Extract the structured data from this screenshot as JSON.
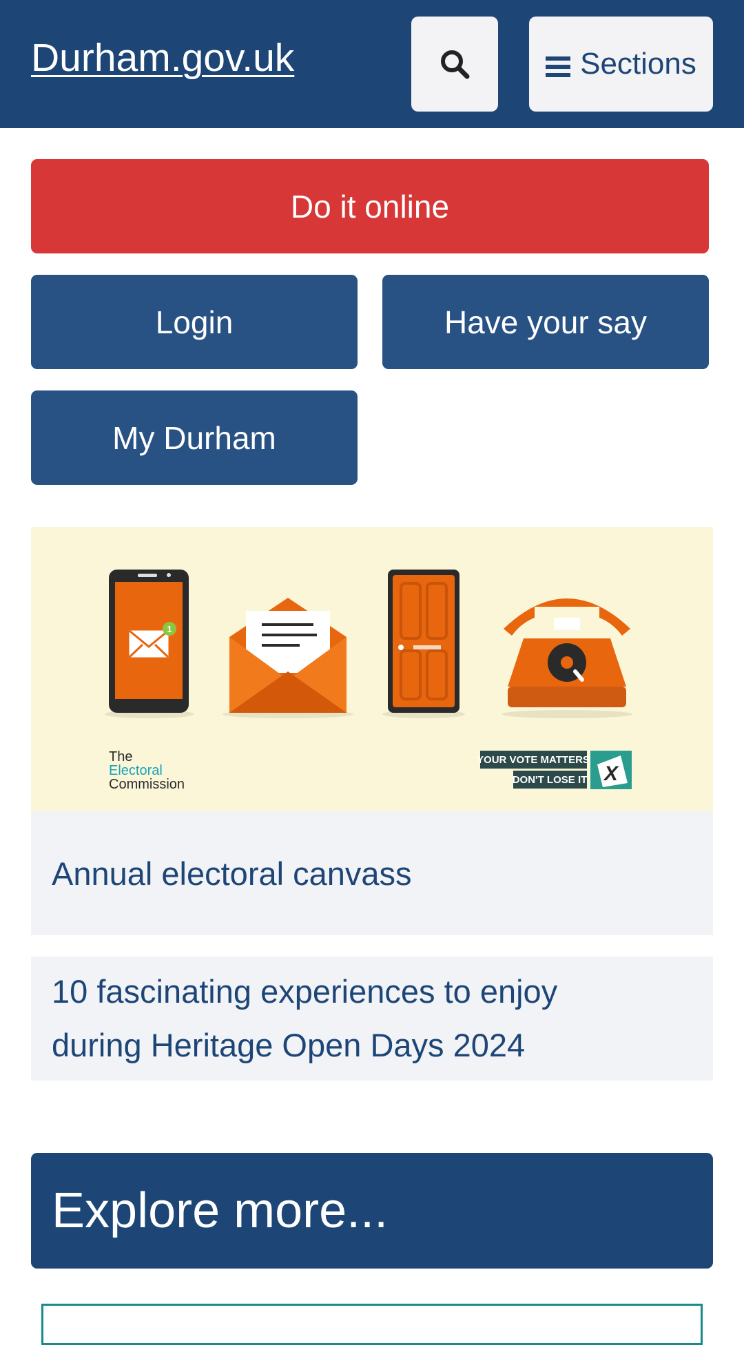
{
  "header": {
    "logo_text": "Durham.gov.uk",
    "search_icon": "search-icon",
    "sections_label": "Sections",
    "menu_icon": "hamburger-menu-icon",
    "background_color": "#1d4677"
  },
  "actions": {
    "do_it_online": "Do it online",
    "login": "Login",
    "have_your_say": "Have your say",
    "my_durham": "My Durham",
    "primary_color": "#d73737",
    "secondary_color": "#285283"
  },
  "banner": {
    "commission_line1": "The",
    "commission_line2": "Electoral",
    "commission_line3": "Commission",
    "vote_line1": "YOUR VOTE MATTERS",
    "vote_line2": "DON'T LOSE IT",
    "ballot_mark": "X",
    "notification_count": "1",
    "icons": [
      "mobile-phone-icon",
      "envelope-icon",
      "door-icon",
      "telephone-icon"
    ]
  },
  "news": [
    {
      "title": "Annual electoral canvass"
    },
    {
      "title_line1": "10 fascinating experiences to enjoy",
      "title_line2": "during Heritage Open Days 2024"
    }
  ],
  "explore": {
    "heading": "Explore more..."
  }
}
